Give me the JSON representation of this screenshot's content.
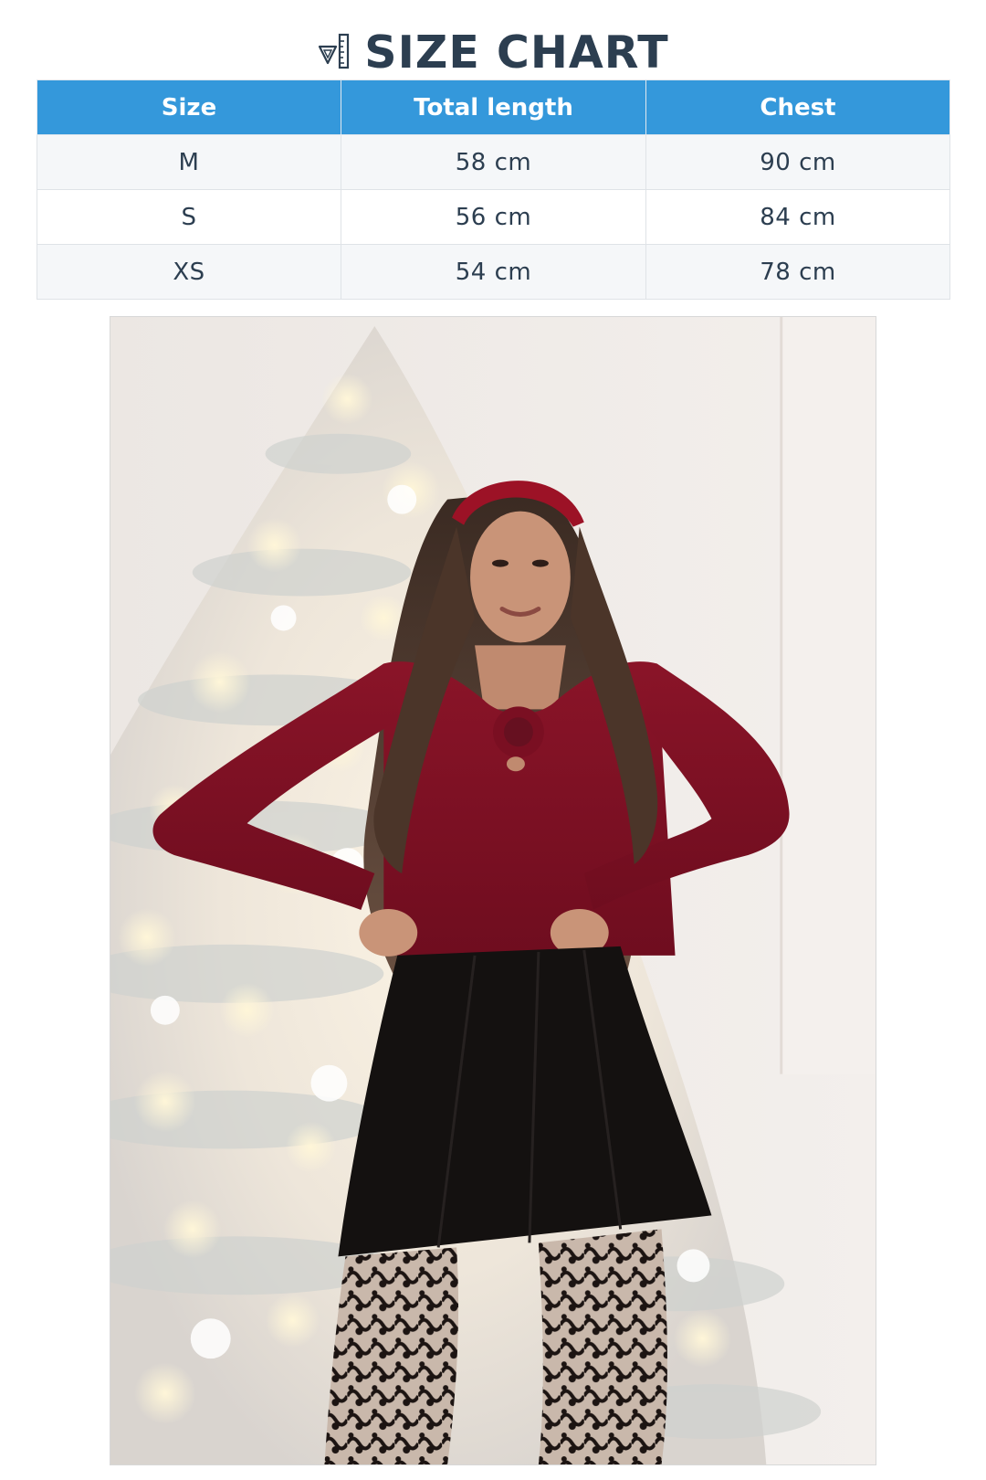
{
  "title": {
    "text": "SIZE CHART",
    "icon": "ruler-triangle-icon"
  },
  "table": {
    "headers": [
      "Size",
      "Total length",
      "Chest"
    ],
    "rows": [
      [
        "M",
        "58 cm",
        "90 cm"
      ],
      [
        "S",
        "56 cm",
        "84 cm"
      ],
      [
        "XS",
        "54 cm",
        "78 cm"
      ]
    ],
    "header_color": "#3498db"
  },
  "photo": {
    "subject": "product-photo"
  },
  "colors": {
    "heading": "#2c3e50",
    "header_bg": "#3498db",
    "row_alt": "#f5f7f9"
  }
}
